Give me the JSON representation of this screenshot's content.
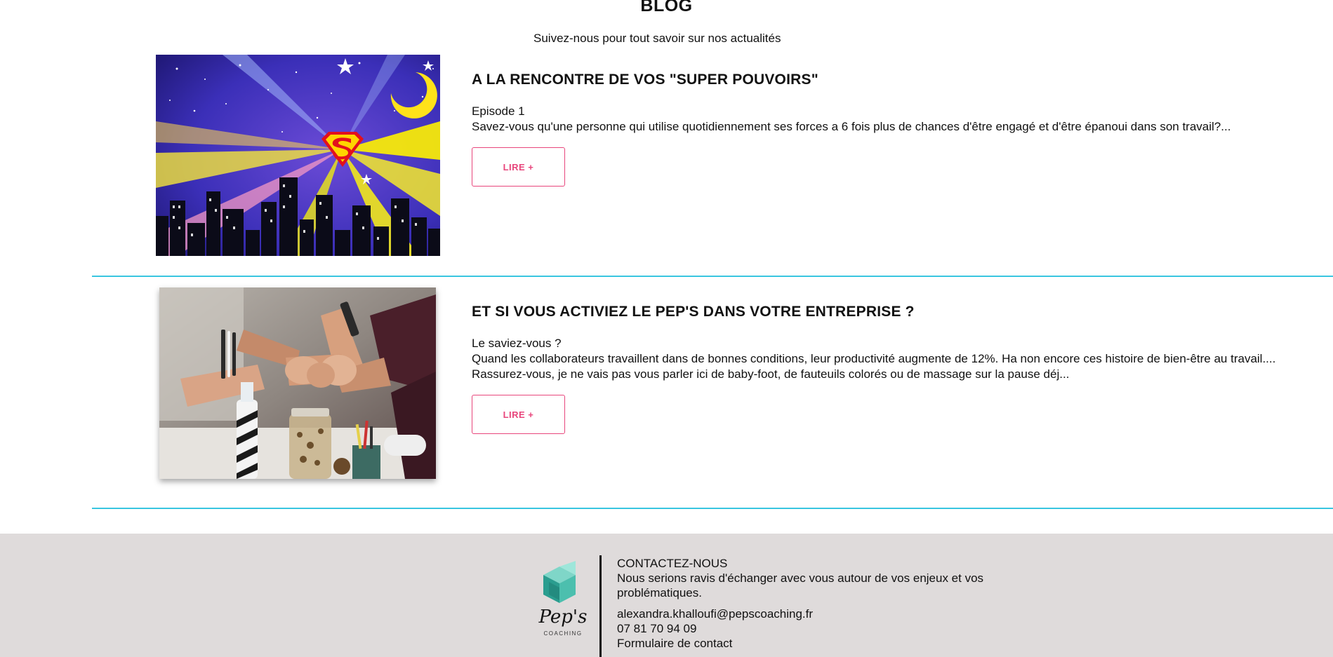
{
  "header": {
    "title": "BLOG",
    "subtitle": "Suivez-nous pour tout savoir sur nos actualités"
  },
  "posts": [
    {
      "title": "A LA RENCONTRE DE VOS \"SUPER POUVOIRS\"",
      "excerpt": [
        "Episode 1",
        "Savez-vous qu'une personne qui utilise quotidiennement ses forces a 6 fois plus de chances d'être engagé et d'être épanoui dans son travail?..."
      ],
      "button_label": "LIRE +",
      "image_icon": "superhero-city-night-image"
    },
    {
      "title": "ET SI VOUS ACTIVIEZ LE PEP'S DANS VOTRE ENTREPRISE ?",
      "excerpt": [
        "Le saviez-vous ?",
        "Quand les collaborateurs travaillent dans de bonnes conditions, leur productivité augmente de 12%. Ha non encore ces histoire de bien-être au travail....",
        "Rassurez-vous, je ne vais pas vous parler ici de baby-foot, de fauteuils colorés ou de massage sur la pause déj..."
      ],
      "button_label": "LIRE +",
      "image_icon": "team-fist-bump-image"
    }
  ],
  "footer": {
    "logo_text": "Pep's",
    "logo_subtext": "COACHING",
    "heading": "CONTACTEZ-NOUS",
    "description": "Nous serions ravis d'échanger avec vous autour de vos enjeux et vos problématiques.",
    "email": "alexandra.khalloufi@pepscoaching.fr",
    "phone": "07 81 70 94 09",
    "form_link": "Formulaire de contact"
  },
  "colors": {
    "accent_pink": "#e8467c",
    "divider_cyan": "#39c6e0",
    "footer_bg": "#dfdbdb"
  }
}
